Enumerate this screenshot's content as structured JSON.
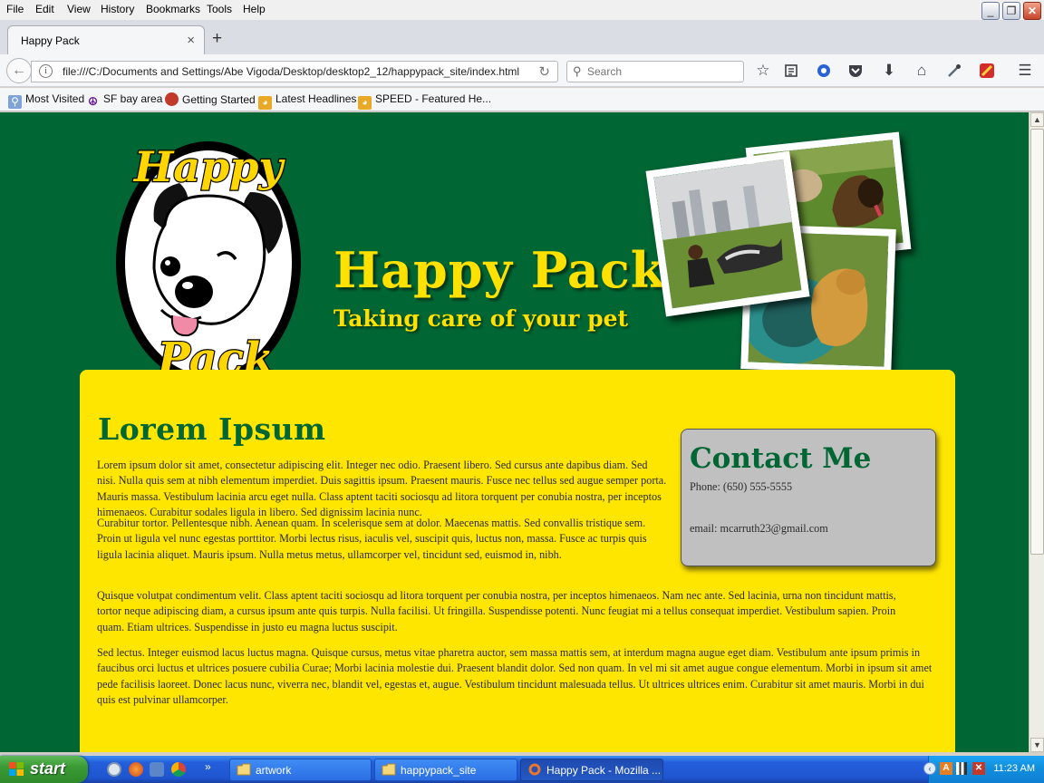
{
  "browser": {
    "menu": [
      "File",
      "Edit",
      "View",
      "History",
      "Bookmarks",
      "Tools",
      "Help"
    ],
    "tab_title": "Happy Pack",
    "url": "file:///C:/Documents and Settings/Abe Vigoda/Desktop/desktop2_12/happypack_site/index.html",
    "search_placeholder": "Search",
    "bookmarks": [
      "Most Visited",
      "SF bay area",
      "Getting Started",
      "Latest Headlines",
      "SPEED - Featured He..."
    ]
  },
  "page": {
    "logo_text_top": "Happy",
    "logo_text_bottom": "Pack",
    "title": "Happy Pack",
    "tagline": "Taking care of your pet",
    "heading": "Lorem Ipsum",
    "paragraphs": [
      "Lorem ipsum dolor sit amet, consectetur adipiscing elit. Integer nec odio. Praesent libero. Sed cursus ante dapibus diam. Sed nisi. Nulla quis sem at nibh elementum imperdiet. Duis sagittis ipsum. Praesent mauris. Fusce nec tellus sed augue semper porta. Mauris massa. Vestibulum lacinia arcu eget nulla. Class aptent taciti sociosqu ad litora torquent per conubia nostra, per inceptos himenaeos. Curabitur sodales ligula in libero. Sed dignissim lacinia nunc.",
      "Curabitur tortor. Pellentesque nibh. Aenean quam. In scelerisque sem at dolor. Maecenas mattis. Sed convallis tristique sem. Proin ut ligula vel nunc egestas porttitor. Morbi lectus risus, iaculis vel, suscipit quis, luctus non, massa. Fusce ac turpis quis ligula lacinia aliquet. Mauris ipsum. Nulla metus metus, ullamcorper vel, tincidunt sed, euismod in, nibh.",
      "Quisque volutpat condimentum velit. Class aptent taciti sociosqu ad litora torquent per conubia nostra, per inceptos himenaeos. Nam nec ante. Sed lacinia, urna non tincidunt mattis, tortor neque adipiscing diam, a cursus ipsum ante quis turpis. Nulla facilisi. Ut fringilla. Suspendisse potenti. Nunc feugiat mi a tellus consequat imperdiet. Vestibulum sapien. Proin quam. Etiam ultrices. Suspendisse in justo eu magna luctus suscipit.",
      "Sed lectus. Integer euismod lacus luctus magna. Quisque cursus, metus vitae pharetra auctor, sem massa mattis sem, at interdum magna augue eget diam. Vestibulum ante ipsum primis in faucibus orci luctus et ultrices posuere cubilia Curae; Morbi lacinia molestie dui. Praesent blandit dolor. Sed non quam. In vel mi sit amet augue congue elementum. Morbi in ipsum sit amet pede facilisis laoreet. Donec lacus nunc, viverra nec, blandit vel, egestas et, augue. Vestibulum tincidunt malesuada tellus. Ut ultrices ultrices enim. Curabitur sit amet mauris. Morbi in dui quis est pulvinar ullamcorper."
    ],
    "contact": {
      "heading": "Contact Me",
      "phone": "Phone: (650) 555-5555",
      "email": "email: mcarruth23@gmail.com"
    },
    "colors": {
      "background": "#006633",
      "content": "#ffe600",
      "accent": "#ffe100",
      "contact_box": "#c0c0c0"
    }
  },
  "taskbar": {
    "start_label": "start",
    "tasks": [
      "artwork",
      "happypack_site",
      "Happy Pack - Mozilla ..."
    ],
    "clock": "11:23 AM"
  }
}
